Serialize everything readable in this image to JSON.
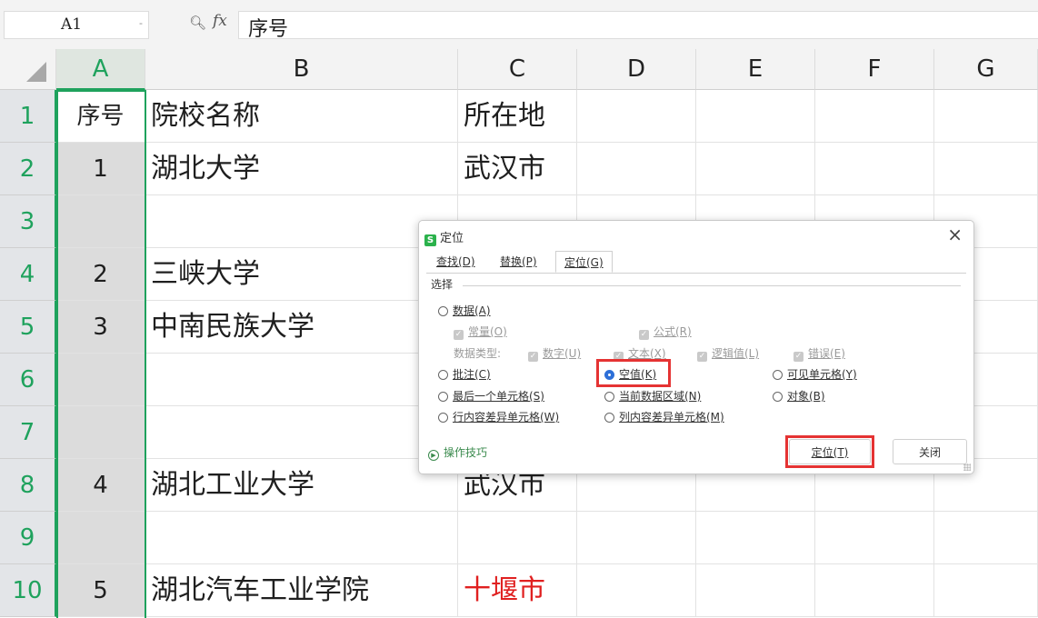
{
  "formula_bar": {
    "cell_ref": "A1",
    "dropdown_glyph": "-",
    "zoom_icon": "zoom-icon",
    "fx_label": "fx",
    "content": "序号"
  },
  "columns": [
    "A",
    "B",
    "C",
    "D",
    "E",
    "F",
    "G"
  ],
  "rows": [
    {
      "num": "1",
      "a": "序号",
      "b": "院校名称",
      "c": "所在地"
    },
    {
      "num": "2",
      "a": "1",
      "b": "湖北大学",
      "c": "武汉市"
    },
    {
      "num": "3",
      "a": "",
      "b": "",
      "c": ""
    },
    {
      "num": "4",
      "a": "2",
      "b": "三峡大学",
      "c": ""
    },
    {
      "num": "5",
      "a": "3",
      "b": "中南民族大学",
      "c": ""
    },
    {
      "num": "6",
      "a": "",
      "b": "",
      "c": ""
    },
    {
      "num": "7",
      "a": "",
      "b": "",
      "c": ""
    },
    {
      "num": "8",
      "a": "4",
      "b": "湖北工业大学",
      "c": "武汉市"
    },
    {
      "num": "9",
      "a": "",
      "b": "",
      "c": ""
    },
    {
      "num": "10",
      "a": "5",
      "b": "湖北汽车工业学院",
      "c": "十堰市"
    }
  ],
  "colors": {
    "accent": "#1fa25d",
    "highlight_text": "#e02020",
    "annotation_box": "#e53333"
  },
  "dialog": {
    "title": "定位",
    "logo": "S",
    "close_glyph": "×",
    "tabs": [
      "查找(D)",
      "替换(P)",
      "定位(G)"
    ],
    "active_tab": "定位(G)",
    "section_label": "选择",
    "options": {
      "data": "数据(A)",
      "constant": "常量(O)",
      "formula": "公式(R)",
      "data_type_label": "数据类型:",
      "number": "数字(U)",
      "text": "文本(X)",
      "logical": "逻辑值(L)",
      "error": "错误(E)",
      "comment": "批注(C)",
      "blank": "空值(K)",
      "visible": "可见单元格(Y)",
      "last_cell": "最后一个单元格(S)",
      "current_region": "当前数据区域(N)",
      "object": "对象(B)",
      "row_diff": "行内容差异单元格(W)",
      "col_diff": "列内容差异单元格(M)"
    },
    "selected_option": "空值(K)",
    "tips_label": "操作技巧",
    "locate_button": "定位(T)",
    "close_button": "关闭"
  }
}
